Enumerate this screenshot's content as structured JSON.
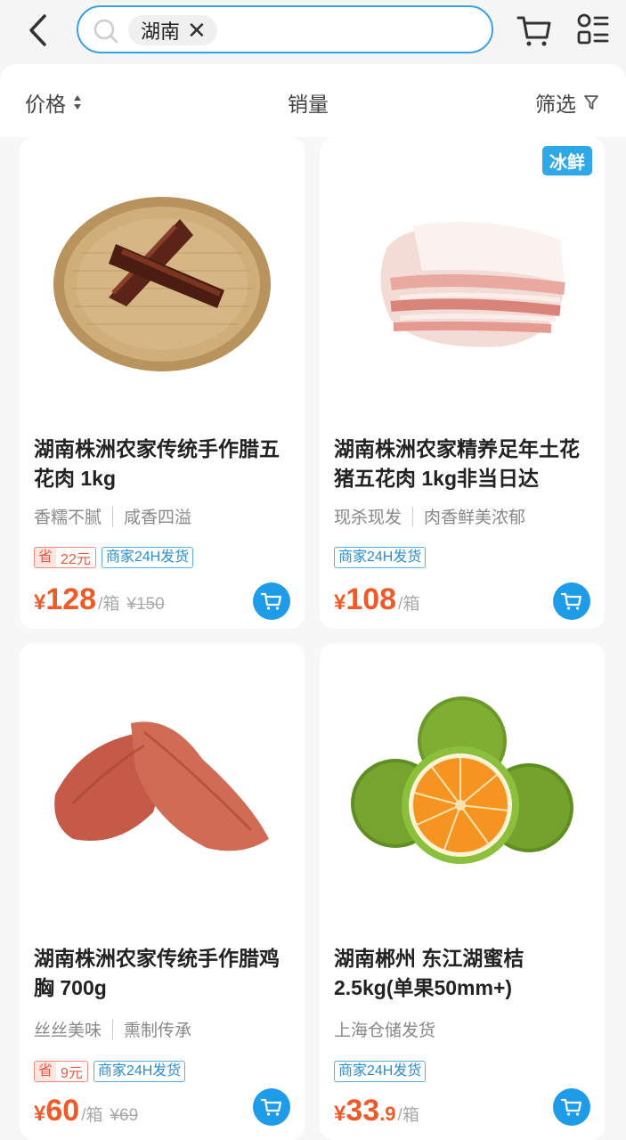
{
  "search": {
    "tag": "湖南"
  },
  "sort": {
    "price": "价格",
    "sales": "销量",
    "filter": "筛选"
  },
  "products": [
    {
      "badge": "",
      "title": "湖南株洲农家传统手作腊五花肉 1kg",
      "features": [
        "香糯不腻",
        "咸香四溢"
      ],
      "save_prefix": "省",
      "save_amount": "22元",
      "ship": "商家24H发货",
      "price_symbol": "¥",
      "price_main": "128",
      "price_decimal": "",
      "unit": "/箱",
      "old_price": "¥150"
    },
    {
      "badge": "冰鲜",
      "title": "湖南株洲农家精养足年土花猪五花肉 1kg非当日达",
      "features": [
        "现杀现发",
        "肉香鲜美浓郁"
      ],
      "save_prefix": "",
      "save_amount": "",
      "ship": "商家24H发货",
      "price_symbol": "¥",
      "price_main": "108",
      "price_decimal": "",
      "unit": "/箱",
      "old_price": ""
    },
    {
      "badge": "",
      "title": "湖南株洲农家传统手作腊鸡胸 700g",
      "features": [
        "丝丝美味",
        "熏制传承"
      ],
      "save_prefix": "省",
      "save_amount": "9元",
      "ship": "商家24H发货",
      "price_symbol": "¥",
      "price_main": "60",
      "price_decimal": "",
      "unit": "/箱",
      "old_price": "¥69"
    },
    {
      "badge": "",
      "title": "湖南郴州 东江湖蜜桔 2.5kg(单果50mm+)",
      "features": [
        "上海仓储发货"
      ],
      "save_prefix": "",
      "save_amount": "",
      "ship": "商家24H发货",
      "price_symbol": "¥",
      "price_main": "33",
      "price_decimal": ".9",
      "unit": "/箱",
      "old_price": ""
    }
  ],
  "colors": {
    "accent": "#1e9ce8",
    "price": "#f05a28"
  }
}
